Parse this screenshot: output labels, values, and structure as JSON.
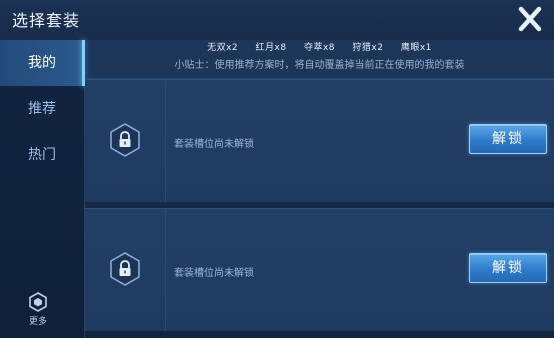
{
  "header": {
    "title": "选择套装",
    "close_icon": "close-icon"
  },
  "sidebar": {
    "tabs": [
      {
        "label": "我的",
        "active": true
      },
      {
        "label": "推荐",
        "active": false
      },
      {
        "label": "热门",
        "active": false
      }
    ],
    "more": {
      "label": "更多",
      "icon": "hexagon-more-icon"
    }
  },
  "summary": {
    "items": [
      "无双x2",
      "红月x8",
      "夺萃x8",
      "狩猎x2",
      "鹰眼x1"
    ]
  },
  "tip": "小贴士：使用推荐方案时，将自动覆盖掉当前正在使用的我的套装",
  "slots": [
    {
      "status_text": "套装槽位尚未解锁",
      "button_label": "解锁",
      "icon": "lock-icon"
    },
    {
      "status_text": "套装槽位尚未解锁",
      "button_label": "解锁",
      "icon": "lock-icon"
    }
  ],
  "colors": {
    "accent": "#7fd1ff",
    "button": "#2f7ccb",
    "background": "#16294a"
  }
}
